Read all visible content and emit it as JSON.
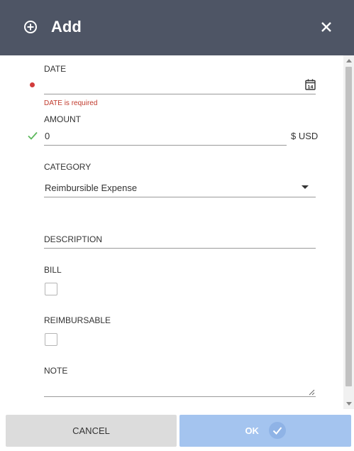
{
  "header": {
    "title": "Add",
    "add_icon": "plus-circle-icon",
    "close_icon": "close-icon"
  },
  "form": {
    "date": {
      "label": "DATE",
      "value": "",
      "error": "DATE is required",
      "icon": "calendar-icon",
      "icon_text": "14"
    },
    "amount": {
      "label": "AMOUNT",
      "value": "0",
      "suffix": "$ USD",
      "status_icon": "check-icon"
    },
    "category": {
      "label": "CATEGORY",
      "value": "Reimbursible Expense"
    },
    "description": {
      "label": "DESCRIPTION",
      "value": ""
    },
    "bill": {
      "label": "BILL",
      "checked": false
    },
    "reimbursable": {
      "label": "REIMBURSABLE",
      "checked": false
    },
    "note": {
      "label": "NOTE",
      "value": ""
    }
  },
  "footer": {
    "cancel_label": "CANCEL",
    "ok_label": "OK"
  },
  "colors": {
    "header_bg": "#4e5565",
    "error": "#d23c3c",
    "success": "#5cb85c",
    "ok_button": "#a4c4ef",
    "cancel_button": "#dcdcdc"
  }
}
